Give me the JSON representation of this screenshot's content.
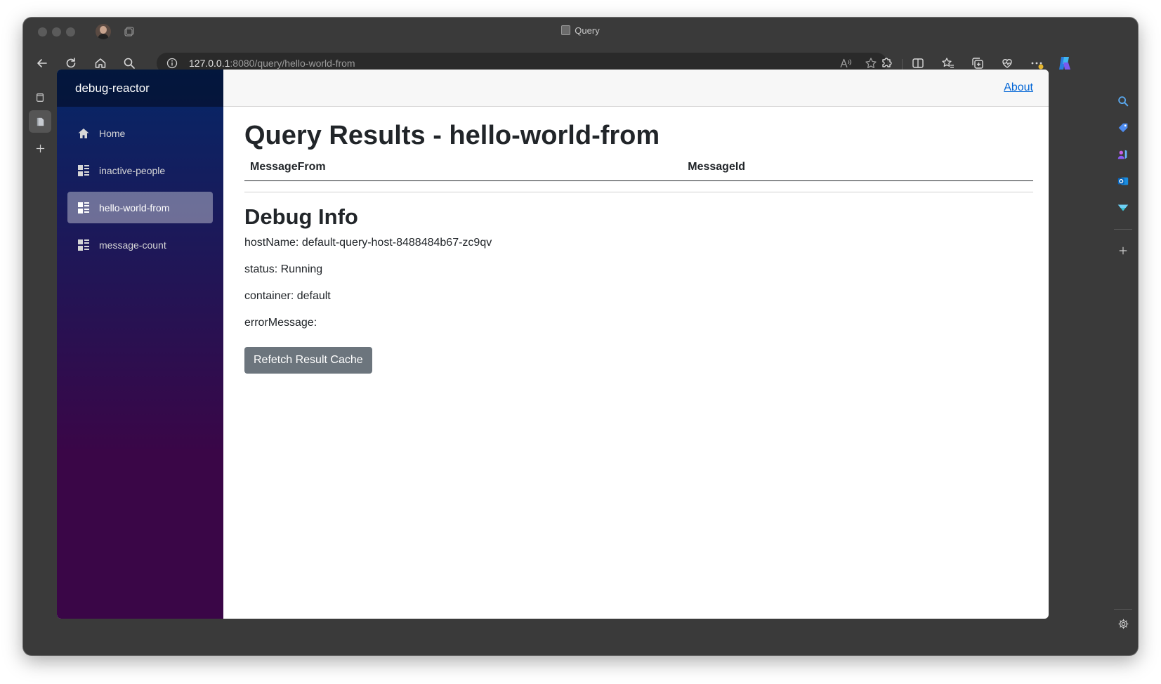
{
  "browser": {
    "tab_title": "Query",
    "url_host": "127.0.0.1",
    "url_rest": ":8080/query/hello-world-from"
  },
  "app": {
    "brand": "debug-reactor",
    "about_link": "About",
    "nav": [
      {
        "label": "Home",
        "icon": "home-icon"
      },
      {
        "label": "inactive-people",
        "icon": "list-icon"
      },
      {
        "label": "hello-world-from",
        "icon": "list-icon",
        "active": true
      },
      {
        "label": "message-count",
        "icon": "list-icon"
      }
    ]
  },
  "page": {
    "title": "Query Results - hello-world-from",
    "columns": [
      "MessageFrom",
      "MessageId"
    ],
    "debug_title": "Debug Info",
    "debug": [
      "hostName: default-query-host-8488484b67-zc9qv",
      "status: Running",
      "container: default",
      "errorMessage:"
    ],
    "refetch_button": "Refetch Result Cache"
  },
  "colors": {
    "sidebar_top": "#052767",
    "sidebar_bottom": "#3a0647",
    "link": "#0366d6",
    "button": "#6c757d"
  }
}
